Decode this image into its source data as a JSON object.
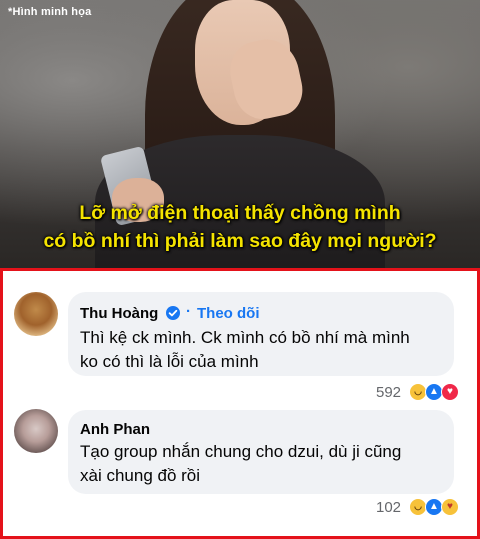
{
  "image": {
    "watermark": "*Hình minh họa",
    "caption_line1": "Lỡ mở điện thoại thấy chồng mình",
    "caption_line2": "có bồ nhí thì phải làm sao đây mọi người?"
  },
  "comments": [
    {
      "name": "Thu Hoàng",
      "verified": true,
      "separator": "·",
      "follow_label": "Theo dõi",
      "text_line1": "Thì kệ ck mình. Ck mình có bồ nhí mà mình",
      "text_line2": "ko có thì là lỗi của mình",
      "reaction_count": "592",
      "reactions": [
        "haha-icon",
        "like-icon",
        "love-icon"
      ]
    },
    {
      "name": "Anh Phan",
      "text_line1": "Tạo group nhắn chung cho dzui, dù ji cũng",
      "text_line2": "xài chung đồ rồi",
      "reaction_count": "102",
      "reactions": [
        "haha-icon",
        "like-icon",
        "care-icon"
      ]
    }
  ],
  "colors": {
    "frame": "#e4121a",
    "caption": "#f5e400",
    "facebook_blue": "#1877f2",
    "bubble": "#f0f2f5"
  }
}
